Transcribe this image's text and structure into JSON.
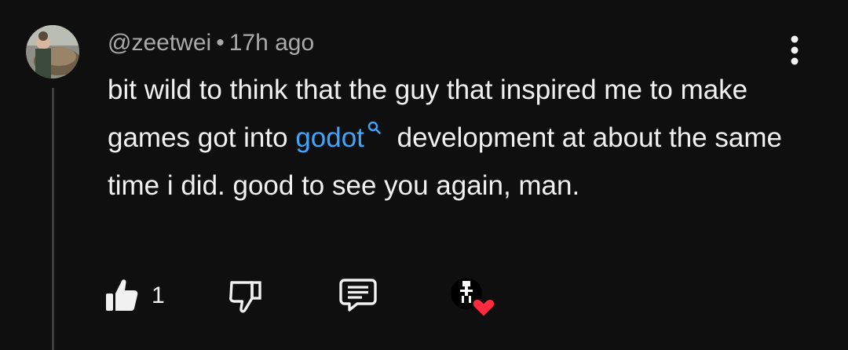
{
  "comment": {
    "author": "@zeetwei",
    "separator": "•",
    "time": "17h ago",
    "text_before_link": "bit wild to think that the guy that inspired me to make games got into ",
    "link_text": "godot",
    "text_after_link": " development at about the same time i did. good to see you again, man.",
    "like_count": "1"
  },
  "icons": {
    "menu": "vertical-dots-icon",
    "search_link": "search-icon",
    "like": "thumbs-up-filled-icon",
    "dislike": "thumbs-down-outline-icon",
    "reply": "comment-bubble-icon",
    "creator_heart": "creator-heart-badge"
  },
  "colors": {
    "background": "#0f0f0f",
    "text": "#f1f1f1",
    "meta": "#aaaaaa",
    "link": "#3ea6ff",
    "heart": "#ff2a3d"
  }
}
